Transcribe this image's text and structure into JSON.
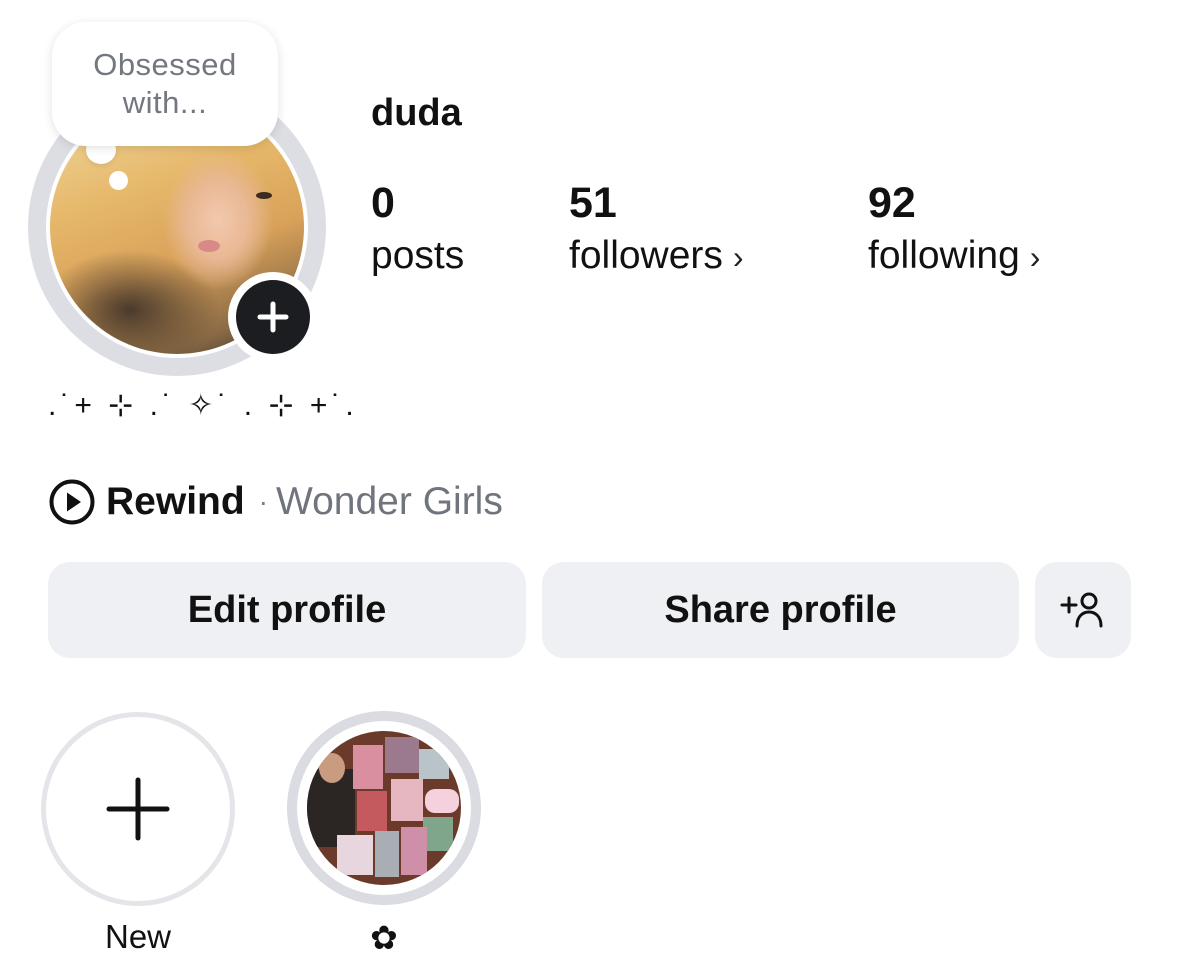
{
  "profile": {
    "username": "duda",
    "note_bubble": "Obsessed with...",
    "bio_decoration": ".˙+ ⊹ .˙ ✧˙ . ⊹ +˙.",
    "stats": [
      {
        "value": "0",
        "label": "posts",
        "has_chevron": false
      },
      {
        "value": "51",
        "label": "followers",
        "has_chevron": true
      },
      {
        "value": "92",
        "label": "following",
        "has_chevron": true
      }
    ],
    "chevron": "›"
  },
  "music": {
    "title": "Rewind",
    "separator": "·",
    "artist": "Wonder Girls",
    "icon": "play-circle-icon"
  },
  "actions": {
    "edit_label": "Edit profile",
    "share_label": "Share profile",
    "add_person_icon": "add-person-icon"
  },
  "highlights": [
    {
      "label": "New",
      "icon": "plus-icon"
    },
    {
      "label": "✿",
      "icon": "collage-cover"
    }
  ],
  "colors": {
    "button_bg": "#eef0f3",
    "secondary_text": "#6f747d",
    "badge_bg": "#1c1d20",
    "ring": "#dcdee3"
  }
}
